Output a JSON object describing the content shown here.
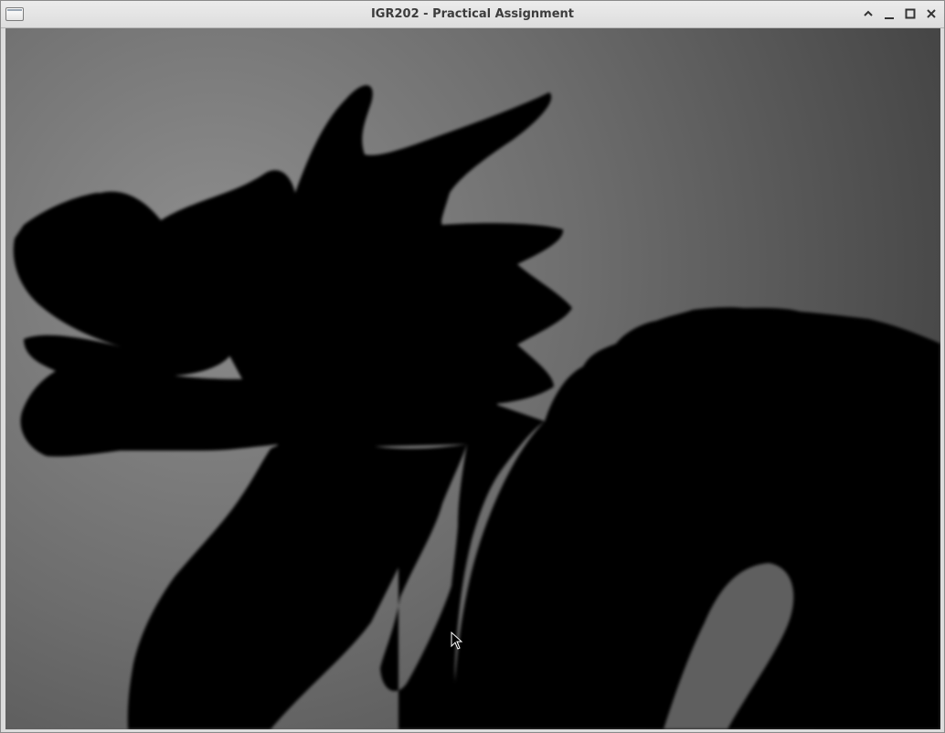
{
  "window": {
    "title": "IGR202 - Practical Assignment",
    "icons": [
      "app-window-icon",
      "maximize-up-icon",
      "minimize-icon",
      "restore-icon",
      "close-icon"
    ]
  },
  "viewport": {
    "content": "dragon-silhouette-render",
    "colors": {
      "background_light": "#8e8e8e",
      "background_dark": "#3f3f3f",
      "silhouette": "#000000"
    }
  },
  "cursor": {
    "icon": "mouse-pointer-icon"
  }
}
